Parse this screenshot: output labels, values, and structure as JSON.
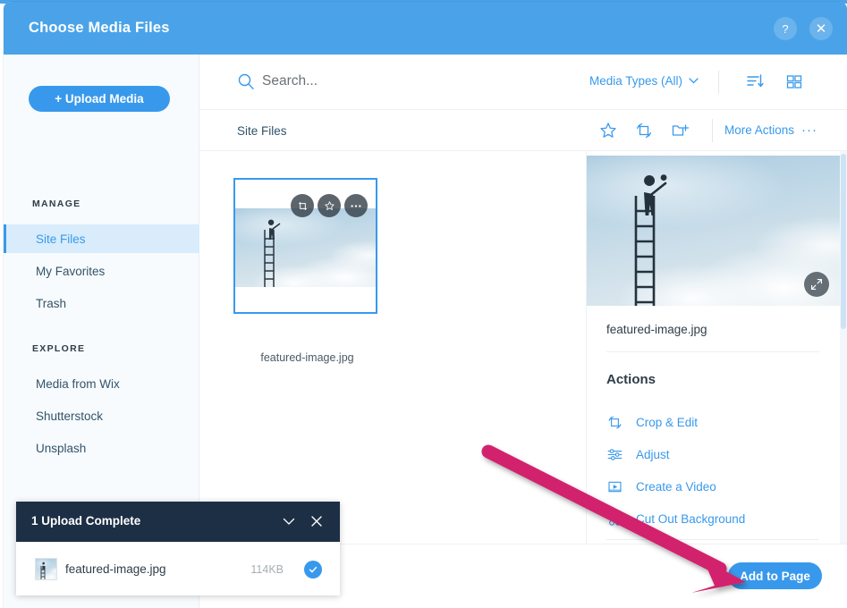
{
  "dialog": {
    "title": "Choose Media Files",
    "help_label": "?",
    "close_label": "✕"
  },
  "sidebar": {
    "upload_button": "+ Upload Media",
    "sections": [
      {
        "title": "MANAGE",
        "items": [
          {
            "label": "Site Files",
            "active": true
          },
          {
            "label": "My Favorites",
            "active": false
          },
          {
            "label": "Trash",
            "active": false
          }
        ]
      },
      {
        "title": "EXPLORE",
        "items": [
          {
            "label": "Media from Wix",
            "active": false
          },
          {
            "label": "Shutterstock",
            "active": false
          },
          {
            "label": "Unsplash",
            "active": false
          }
        ]
      }
    ]
  },
  "search": {
    "placeholder": "Search...",
    "value": "",
    "icon": "search-icon"
  },
  "toolbar": {
    "media_types_label": "Media Types (All)",
    "chevron": "⌄",
    "sort_icon": "sort-icon",
    "grid_view_icon": "grid-view-icon"
  },
  "actionbar": {
    "breadcrumb": "Site Files",
    "favorite_icon": "star-icon",
    "crop_icon": "crop-icon",
    "new_folder_icon": "new-folder-icon",
    "more_actions_label": "More Actions",
    "more_actions_dots": "···"
  },
  "grid": {
    "card": {
      "filename": "featured-image.jpg",
      "selected": true,
      "overlay_buttons": [
        "crop-icon",
        "star-icon",
        "ellipsis-icon"
      ]
    }
  },
  "detail": {
    "filename": "featured-image.jpg",
    "expand_icon": "expand-icon",
    "actions_heading": "Actions",
    "actions": [
      {
        "label": "Crop & Edit",
        "icon": "crop-icon"
      },
      {
        "label": "Adjust",
        "icon": "adjust-sliders-icon"
      },
      {
        "label": "Create a Video",
        "icon": "video-icon"
      },
      {
        "label": "Cut Out Background",
        "icon": "cut-out-icon"
      }
    ]
  },
  "footer": {
    "primary_button": "Add to Page"
  },
  "toast": {
    "title": "1 Upload Complete",
    "collapse_icon": "chevron-down-icon",
    "close_icon": "close-icon",
    "file": {
      "name": "featured-image.jpg",
      "size": "114KB",
      "status_icon": "check-icon"
    }
  },
  "annotation": {
    "type": "arrow",
    "color": "#d2246e",
    "points_to": "Add to Page"
  },
  "colors": {
    "brand_blue": "#3899ec",
    "header_blue": "#4aa3e8",
    "selected_nav": "#d8ecfb",
    "toast_dark": "#1d2f45",
    "annotation_pink": "#d2246e",
    "text_dark": "#2e3d49"
  }
}
